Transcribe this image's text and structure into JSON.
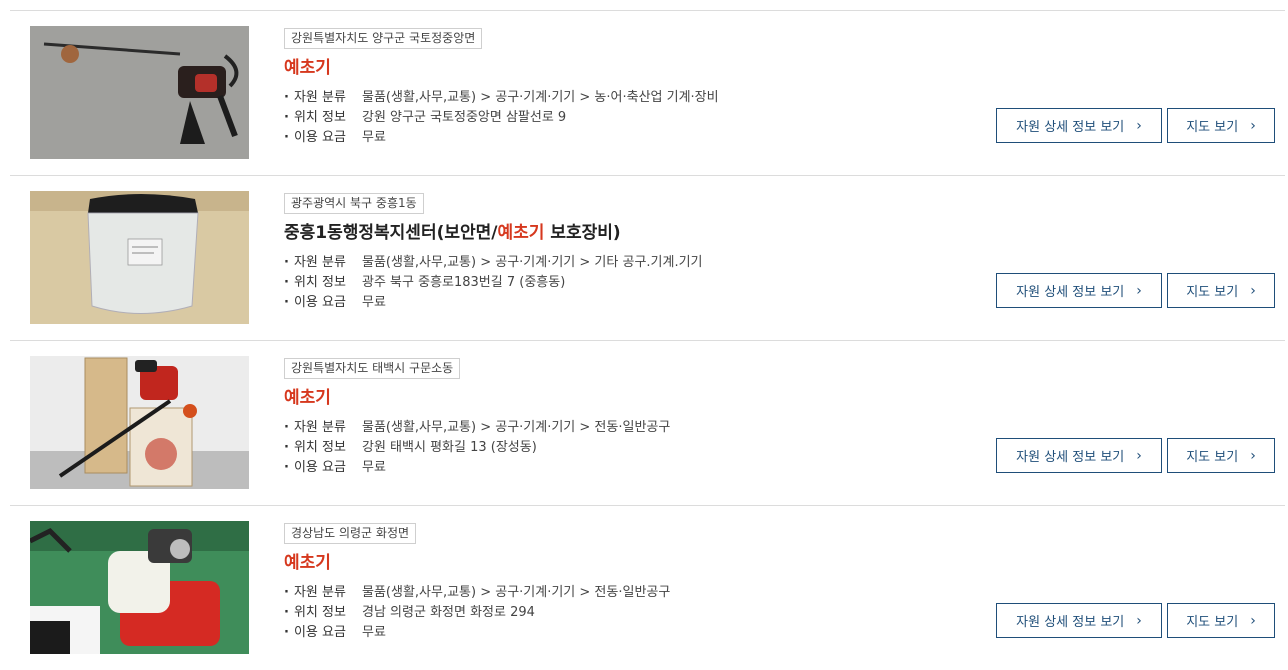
{
  "items": [
    {
      "region": "강원특별자치도 양구군 국토정중앙면",
      "title_pre": "",
      "title_hl": "예초기",
      "title_post": "",
      "category_label": "자원 분류",
      "category": "물품(생활,사무,교통) > 공구·기계·기기 > 농·어·축산업 기계·장비",
      "location_label": "위치 정보",
      "location": "강원 양구군 국토정중앙면 삼팔선로 9",
      "fee_label": "이용 요금",
      "fee": "무료",
      "detail_btn": "자원 상세 정보 보기",
      "map_btn": "지도 보기"
    },
    {
      "region": "광주광역시 북구 중흥1동",
      "title_pre": "중흥1동행정복지센터(보안면/",
      "title_hl": "예초기",
      "title_post": " 보호장비)",
      "category_label": "자원 분류",
      "category": "물품(생활,사무,교통) > 공구·기계·기기 > 기타 공구.기계.기기",
      "location_label": "위치 정보",
      "location": "광주 북구 중흥로183번길 7 (중흥동)",
      "fee_label": "이용 요금",
      "fee": "무료",
      "detail_btn": "자원 상세 정보 보기",
      "map_btn": "지도 보기"
    },
    {
      "region": "강원특별자치도 태백시 구문소동",
      "title_pre": "",
      "title_hl": "예초기",
      "title_post": "",
      "category_label": "자원 분류",
      "category": "물품(생활,사무,교통) > 공구·기계·기기 > 전동·일반공구",
      "location_label": "위치 정보",
      "location": "강원 태백시 평화길 13 (장성동)",
      "fee_label": "이용 요금",
      "fee": "무료",
      "detail_btn": "자원 상세 정보 보기",
      "map_btn": "지도 보기"
    },
    {
      "region": "경상남도 의령군 화정면",
      "title_pre": "",
      "title_hl": "예초기",
      "title_post": "",
      "category_label": "자원 분류",
      "category": "물품(생활,사무,교통) > 공구·기계·기기 > 전동·일반공구",
      "location_label": "위치 정보",
      "location": "경남 의령군 화정면 화정로 294",
      "fee_label": "이용 요금",
      "fee": "무료",
      "detail_btn": "자원 상세 정보 보기",
      "map_btn": "지도 보기"
    }
  ],
  "colors": {
    "highlight": "#d6381e",
    "button_border": "#1f4e79",
    "divider": "#dcdcdc"
  }
}
